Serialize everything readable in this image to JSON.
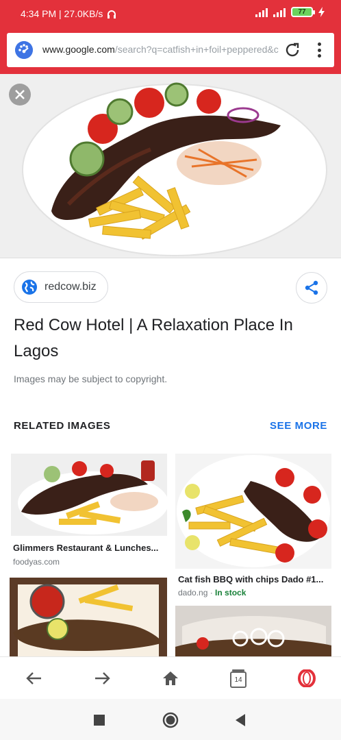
{
  "status_bar": {
    "time_speed": "4:34 PM | 27.0KB/s",
    "battery": "77"
  },
  "address_bar": {
    "domain": "www.google.com",
    "path": "/search?q=catfish+in+foil+peppered&c"
  },
  "result": {
    "source": "redcow.biz",
    "title": "Red Cow Hotel | A Relaxation Place In Lagos",
    "copyright_note": "Images may be subject to copyright."
  },
  "related": {
    "heading": "RELATED IMAGES",
    "see_more": "SEE MORE",
    "items": [
      {
        "title": "Glimmers Restaurant & Lunches...",
        "source": "foodyas.com",
        "stock": ""
      },
      {
        "title": "Cat fish BBQ with chips Dado #1...",
        "source": "dado.ng · ",
        "stock": "In stock"
      }
    ]
  },
  "browser_nav": {
    "tabs_count": "14"
  },
  "colors": {
    "brand_red": "#e3313b",
    "link_blue": "#1a73e8",
    "stock_green": "#188038"
  }
}
